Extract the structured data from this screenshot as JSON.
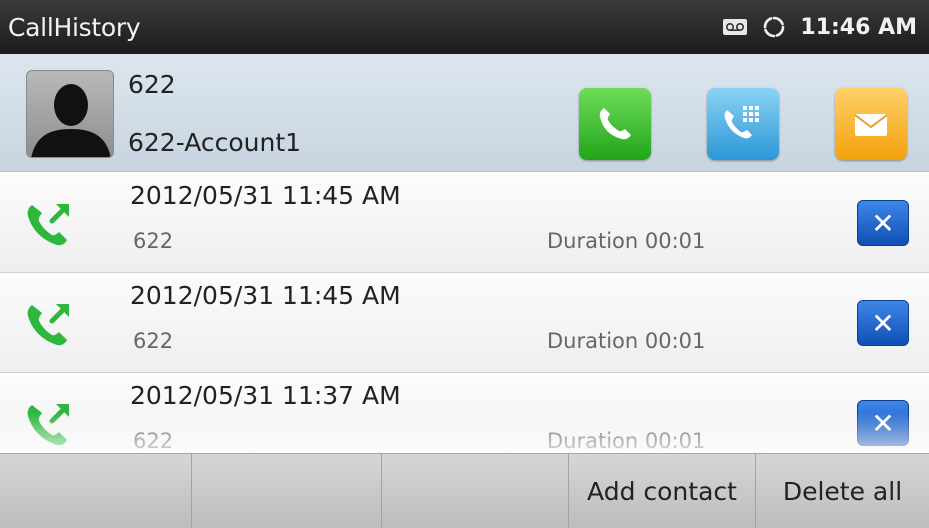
{
  "statusbar": {
    "title": "CallHistory",
    "time": "11:46 AM",
    "icons": [
      "voicemail-icon",
      "sync-icon"
    ]
  },
  "contact": {
    "number": "622",
    "account": "622-Account1",
    "actions": [
      "call-icon",
      "dialpad-icon",
      "message-icon"
    ]
  },
  "calls": [
    {
      "datetime": "2012/05/31 11:45 AM",
      "number": "622",
      "duration": "Duration 00:01"
    },
    {
      "datetime": "2012/05/31 11:45 AM",
      "number": "622",
      "duration": "Duration 00:01"
    },
    {
      "datetime": "2012/05/31 11:37 AM",
      "number": "622",
      "duration": "Duration 00:01"
    }
  ],
  "softkeys": [
    "",
    "",
    "",
    "Add contact",
    "Delete all"
  ],
  "colors": {
    "call_green": "#21a519",
    "dial_blue": "#2c97d7",
    "message_orange": "#f3a20b",
    "delete_blue": "#1a5cc4"
  }
}
